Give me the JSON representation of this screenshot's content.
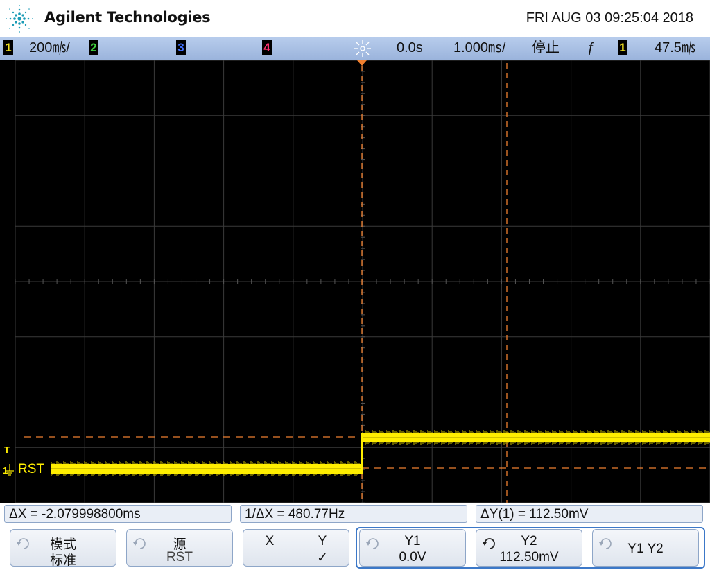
{
  "brand": {
    "name": "Agilent Technologies",
    "datetime": "FRI AUG 03 09:25:04 2018"
  },
  "status": {
    "ch1": {
      "num": "1",
      "scale": "200㎧/",
      "color": "#f0e020"
    },
    "ch2": {
      "num": "2",
      "color": "#40d040"
    },
    "ch3": {
      "num": "3",
      "color": "#4070ff"
    },
    "ch4": {
      "num": "4",
      "color": "#ff3070"
    },
    "delay": "0.0s",
    "timebase": "1.000㎳/",
    "run_state": "停止",
    "trigger_slope": "ƒ",
    "trigger_ch": "1",
    "trigger_level": "47.5㎧"
  },
  "screen": {
    "channel_label": "RST",
    "trace_color": "#ffee00",
    "cursor_color": "#f08030",
    "grid_color": "#3a3a3a",
    "ground_marker": "1",
    "trigger_marker": "T"
  },
  "cursors": {
    "delta_x": "ΔX = -2.079998800ms",
    "inv_delta_x": "1/ΔX = 480.77Hz",
    "delta_y": "ΔY(1) = 112.50mV"
  },
  "softkeys": {
    "mode": {
      "l1": "模式",
      "l2": "标准"
    },
    "source": {
      "l1": "源",
      "l2": "RST"
    },
    "xy": {
      "x": "X",
      "y": "Y",
      "check": "✓"
    },
    "y1": {
      "l1": "Y1",
      "l2": "0.0V"
    },
    "y2": {
      "l1": "Y2",
      "l2": "112.50mV"
    },
    "y1y2": {
      "l1": "Y1 Y2"
    }
  }
}
